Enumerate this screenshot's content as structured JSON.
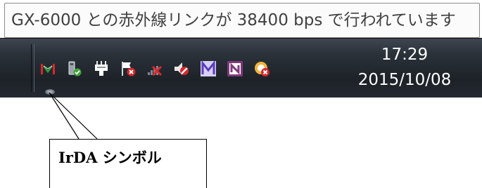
{
  "tooltip": {
    "text": "GX-6000 との赤外線リンクが 38400 bps で行われています"
  },
  "tray": {
    "icons": [
      {
        "name": "irda-icon"
      },
      {
        "name": "network-device-check-icon"
      },
      {
        "name": "power-plug-icon"
      },
      {
        "name": "action-center-flag-x-icon"
      },
      {
        "name": "signal-bars-x-icon"
      },
      {
        "name": "speaker-muted-icon"
      },
      {
        "name": "m-app-icon"
      },
      {
        "name": "onenote-icon"
      },
      {
        "name": "security-x-icon"
      }
    ]
  },
  "clock": {
    "time": "17:29",
    "date": "2015/10/08"
  },
  "callout": {
    "label": "IrDA シンボル"
  },
  "colors": {
    "taskbar": "#242a31",
    "tooltip_bg": "#fbfbfb",
    "irda_red": "#d8262a",
    "irda_green": "#2e9e3a",
    "onenote_purple": "#80397b",
    "m_icon_purple": "#7a5bd0"
  }
}
